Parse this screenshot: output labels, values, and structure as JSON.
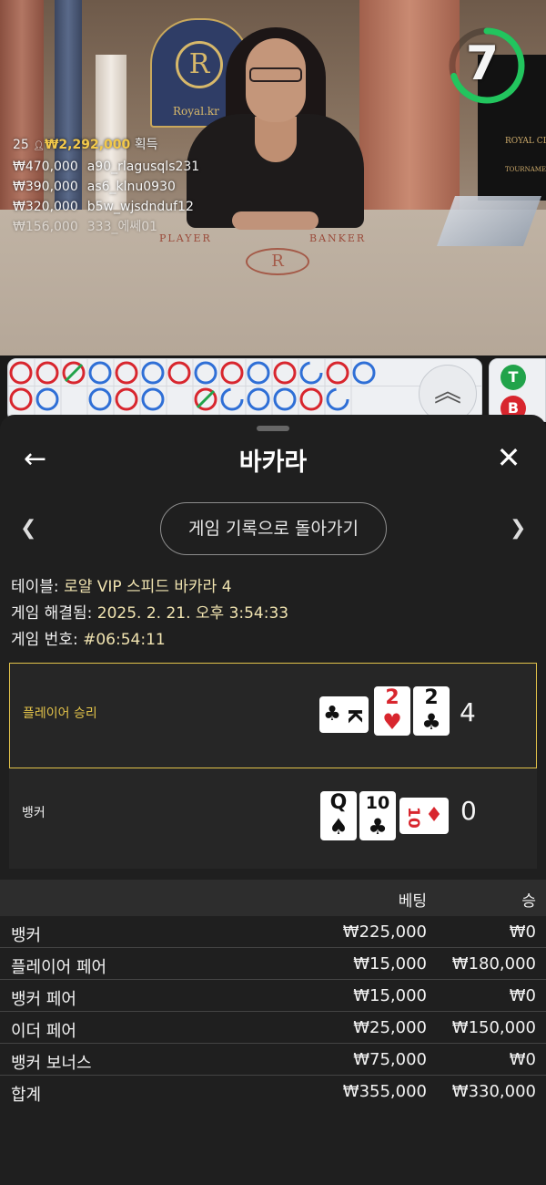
{
  "video": {
    "timer": "7",
    "timer_fraction": 0.7,
    "brand_text": "Royal.kr",
    "side_brand": "ROYAL CL",
    "side_sub": "TOURNAMEN",
    "felt_player": "PLAYER",
    "felt_banker": "BANKER",
    "crest_letter": "R",
    "winners": {
      "count": "25",
      "total": "₩2,292,000",
      "suffix": "획득",
      "rows": [
        {
          "amount": "₩470,000",
          "user": "a90_rlagusqls231"
        },
        {
          "amount": "₩390,000",
          "user": "as6_klnu0930"
        },
        {
          "amount": "₩320,000",
          "user": "b5w_wjsdnduf12"
        },
        {
          "amount": "₩156,000",
          "user": "333_에쎄01"
        }
      ]
    }
  },
  "roadmap": {
    "expand_icon": "chevron-double-up-icon",
    "side_top": "T",
    "side_bottom": "B"
  },
  "sheet": {
    "title": "바카라",
    "back_icon": "arrow-left-icon",
    "close_icon": "close-icon",
    "prev_icon": "chevron-left-icon",
    "next_icon": "chevron-right-icon",
    "back_to_history": "게임 기록으로 돌아가기",
    "info": {
      "table_label": "테이블:",
      "table_value": "로얄 VIP 스피드 바카라 4",
      "resolved_label": "게임 해결됨:",
      "resolved_value": "2025. 2. 21. 오후 3:54:33",
      "number_label": "게임 번호:",
      "number_value": "#06:54:11"
    },
    "player": {
      "label": "플레이어 승리",
      "score": "4",
      "cards": [
        {
          "rank": "K",
          "suit": "♣",
          "color": "black",
          "sideways": true
        },
        {
          "rank": "2",
          "suit": "♥",
          "color": "red",
          "sideways": false
        },
        {
          "rank": "2",
          "suit": "♣",
          "color": "black",
          "sideways": false
        }
      ]
    },
    "banker": {
      "label": "뱅커",
      "score": "0",
      "cards": [
        {
          "rank": "Q",
          "suit": "♠",
          "color": "black",
          "sideways": false
        },
        {
          "rank": "10",
          "suit": "♣",
          "color": "black",
          "sideways": false
        },
        {
          "rank": "10",
          "suit": "♦",
          "color": "red",
          "sideways": true
        }
      ]
    },
    "bets": {
      "col_bet": "베팅",
      "col_win": "승",
      "rows": [
        {
          "name": "뱅커",
          "bet": "₩225,000",
          "win": "₩0"
        },
        {
          "name": "플레이어 페어",
          "bet": "₩15,000",
          "win": "₩180,000"
        },
        {
          "name": "뱅커 페어",
          "bet": "₩15,000",
          "win": "₩0"
        },
        {
          "name": "이더 페어",
          "bet": "₩25,000",
          "win": "₩150,000"
        },
        {
          "name": "뱅커 보너스",
          "bet": "₩75,000",
          "win": "₩0"
        }
      ],
      "total": {
        "name": "합계",
        "bet": "₩355,000",
        "win": "₩330,000"
      }
    }
  },
  "colors": {
    "accent_gold": "#e3c34a",
    "timer_green": "#22c55e",
    "road_red": "#d8262e",
    "road_blue": "#2f6fd6"
  }
}
